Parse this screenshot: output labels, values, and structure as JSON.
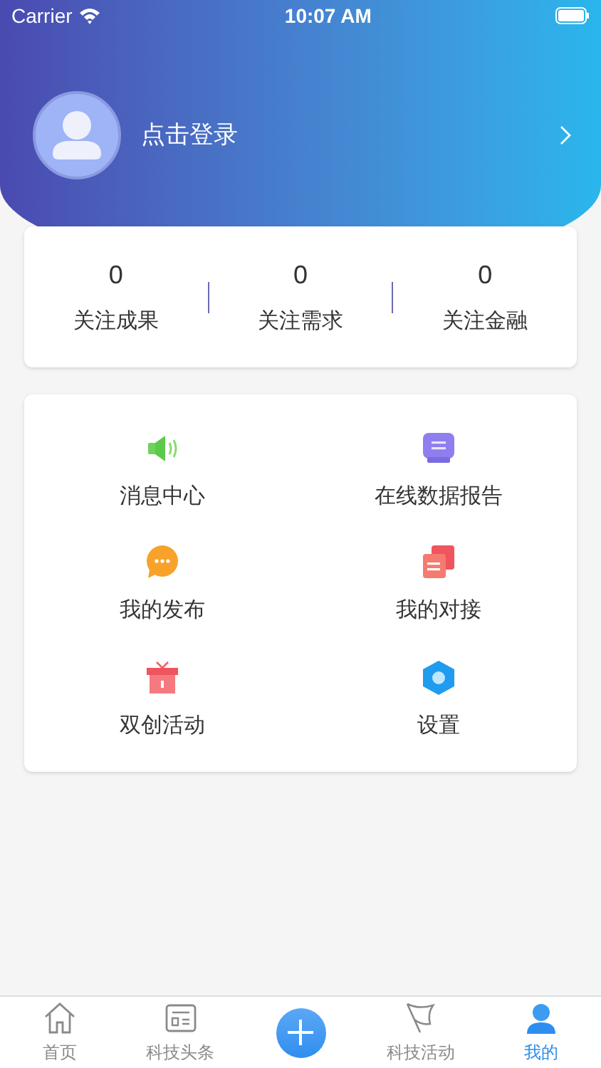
{
  "status_bar": {
    "carrier": "Carrier",
    "time": "10:07 AM"
  },
  "profile": {
    "login_text": "点击登录"
  },
  "stats": [
    {
      "value": "0",
      "label": "关注成果"
    },
    {
      "value": "0",
      "label": "关注需求"
    },
    {
      "value": "0",
      "label": "关注金融"
    }
  ],
  "menu": [
    {
      "label": "消息中心"
    },
    {
      "label": "在线数据报告"
    },
    {
      "label": "我的发布"
    },
    {
      "label": "我的对接"
    },
    {
      "label": "双创活动"
    },
    {
      "label": "设置"
    }
  ],
  "tab_bar": [
    {
      "kind": "tab",
      "label": "首页",
      "selected": false
    },
    {
      "kind": "tab",
      "label": "科技头条",
      "selected": false
    },
    {
      "kind": "add"
    },
    {
      "kind": "tab",
      "label": "科技活动",
      "selected": false
    },
    {
      "kind": "tab",
      "label": "我的",
      "selected": true
    }
  ]
}
